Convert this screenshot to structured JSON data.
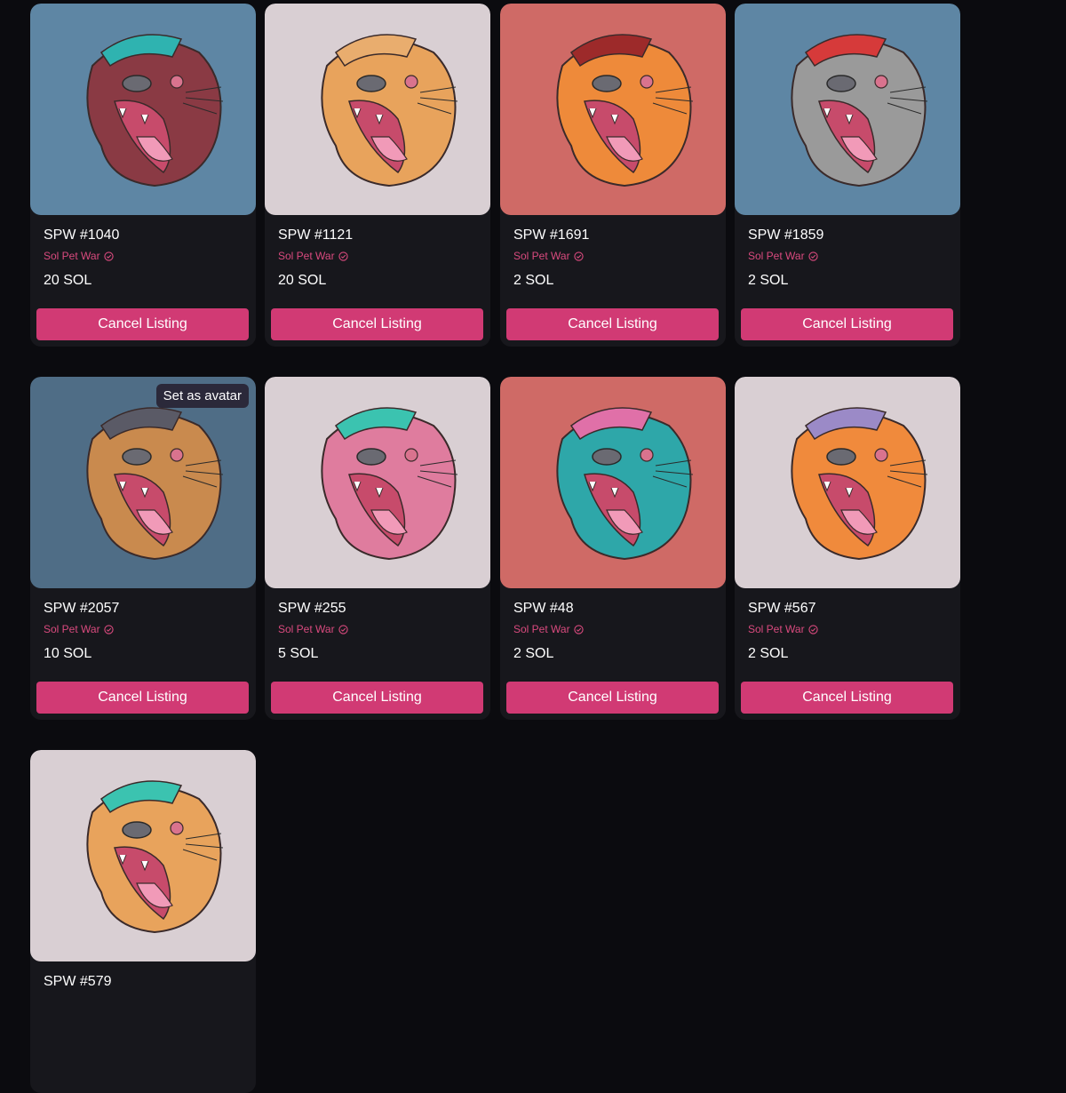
{
  "listings": [
    {
      "title": "SPW #1040",
      "collection": "Sol Pet War",
      "price": "20 SOL",
      "action": "Cancel Listing",
      "bg": "#5e86a4",
      "cat": "#8a3a44",
      "accent": "#2fb3b0"
    },
    {
      "title": "SPW #1121",
      "collection": "Sol Pet War",
      "price": "20 SOL",
      "action": "Cancel Listing",
      "bg": "#d9cfd3",
      "cat": "#e8a35c",
      "accent": "#e9ad6e"
    },
    {
      "title": "SPW #1691",
      "collection": "Sol Pet War",
      "price": "2 SOL",
      "action": "Cancel Listing",
      "bg": "#cf6a66",
      "cat": "#ee8a3a",
      "accent": "#9d2a2a"
    },
    {
      "title": "SPW #1859",
      "collection": "Sol Pet War",
      "price": "2 SOL",
      "action": "Cancel Listing",
      "bg": "#5e86a4",
      "cat": "#9a9a9a",
      "accent": "#d63a3a"
    },
    {
      "title": "SPW #2057",
      "collection": "Sol Pet War",
      "price": "10 SOL",
      "action": "Cancel Listing",
      "bg": "#4f6d86",
      "cat": "#c98a4e",
      "accent": "#5a5a66",
      "avatar_label": "Set as avatar"
    },
    {
      "title": "SPW #255",
      "collection": "Sol Pet War",
      "price": "5 SOL",
      "action": "Cancel Listing",
      "bg": "#d9cfd3",
      "cat": "#df7c9e",
      "accent": "#3bc3b0"
    },
    {
      "title": "SPW #48",
      "collection": "Sol Pet War",
      "price": "2 SOL",
      "action": "Cancel Listing",
      "bg": "#cf6a66",
      "cat": "#2ea7a9",
      "accent": "#e070a8"
    },
    {
      "title": "SPW #567",
      "collection": "Sol Pet War",
      "price": "2 SOL",
      "action": "Cancel Listing",
      "bg": "#d9cfd3",
      "cat": "#f08a3c",
      "accent": "#9b8ac7"
    },
    {
      "title": "SPW #579",
      "bg": "#d9cfd3",
      "cat": "#e8a35c",
      "accent": "#3bc3b0"
    }
  ],
  "icons": {
    "verified": "verified-check-icon"
  }
}
